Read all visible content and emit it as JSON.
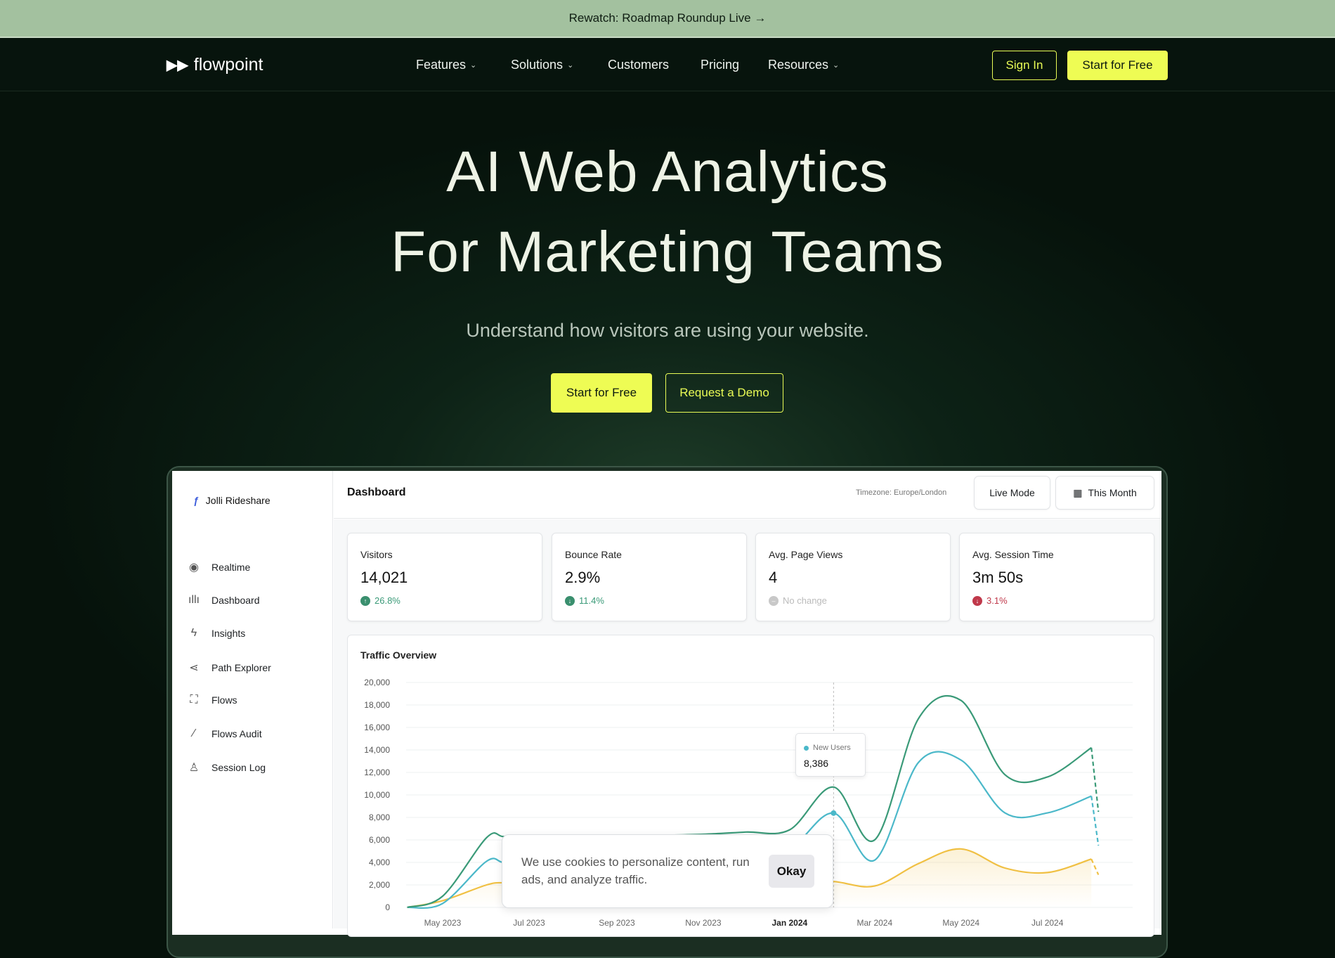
{
  "banner": {
    "text": "Rewatch: Roadmap Roundup Live",
    "arrow": "→"
  },
  "nav": {
    "logo": "flowpoint",
    "items": [
      {
        "label": "Features",
        "dropdown": true
      },
      {
        "label": "Solutions",
        "dropdown": true
      },
      {
        "label": "Customers",
        "dropdown": false
      },
      {
        "label": "Pricing",
        "dropdown": false
      },
      {
        "label": "Resources",
        "dropdown": true
      }
    ],
    "sign_in": "Sign In",
    "start_free": "Start for Free"
  },
  "hero": {
    "title_line1": "AI Web Analytics",
    "title_line2": "For Marketing Teams",
    "subtitle": "Understand how visitors are using your website.",
    "cta_primary": "Start for Free",
    "cta_secondary": "Request a Demo"
  },
  "colors": {
    "accent": "#eefc54",
    "banner": "#a3c19f",
    "background": "#06120b",
    "green": "#3a9a78",
    "teal": "#4bb8c9",
    "yellow": "#f0c043",
    "down": "#c0394b"
  },
  "dashboard": {
    "workspace": "Jolli Rideshare",
    "sidebar": [
      {
        "label": "Realtime",
        "icon": "eye-icon"
      },
      {
        "label": "Dashboard",
        "icon": "bars-icon"
      },
      {
        "label": "Insights",
        "icon": "lightning-icon"
      },
      {
        "label": "Path Explorer",
        "icon": "share-icon"
      },
      {
        "label": "Flows",
        "icon": "flows-icon"
      },
      {
        "label": "Flows Audit",
        "icon": "magic-wand-icon"
      },
      {
        "label": "Session Log",
        "icon": "user-icon"
      }
    ],
    "title": "Dashboard",
    "timezone": "Timezone: Europe/London",
    "live_mode": "Live Mode",
    "range": "This Month",
    "metrics": [
      {
        "label": "Visitors",
        "value": "14,021",
        "change": "26.8%",
        "trend": "up"
      },
      {
        "label": "Bounce Rate",
        "value": "2.9%",
        "change": "11.4%",
        "trend": "down-good"
      },
      {
        "label": "Avg. Page Views",
        "value": "4",
        "change": "No change",
        "trend": "none"
      },
      {
        "label": "Avg. Session Time",
        "value": "3m 50s",
        "change": "3.1%",
        "trend": "down-bad"
      }
    ],
    "chart_title": "Traffic Overview",
    "tooltip": {
      "series": "New Users",
      "value": "8,386"
    }
  },
  "cookie": {
    "text": "We use cookies to personalize content, run ads, and analyze traffic.",
    "button": "Okay"
  },
  "chart_data": {
    "type": "line",
    "title": "Traffic Overview",
    "ylim": [
      0,
      20000
    ],
    "yticks": [
      "0",
      "2,000",
      "4,000",
      "6,000",
      "8,000",
      "10,000",
      "12,000",
      "14,000",
      "16,000",
      "18,000",
      "20,000"
    ],
    "xticks": [
      {
        "label": "May 2023",
        "date": "2023-05-01"
      },
      {
        "label": "Jul 2023",
        "date": "2023-07-01"
      },
      {
        "label": "Sep 2023",
        "date": "2023-09-01"
      },
      {
        "label": "Nov 2023",
        "date": "2023-11-01"
      },
      {
        "label": "Jan 2024",
        "date": "2024-01-01",
        "bold": true
      },
      {
        "label": "Mar 2024",
        "date": "2024-03-01"
      },
      {
        "label": "May 2024",
        "date": "2024-05-01"
      },
      {
        "label": "Jul 2024",
        "date": "2024-07-01"
      }
    ],
    "grid": true,
    "x": [
      "2023-04-06",
      "2023-05-01",
      "2023-06-01",
      "2023-06-13",
      "2023-07-01",
      "2023-08-01",
      "2023-09-01",
      "2023-10-01",
      "2023-11-01",
      "2023-12-01",
      "2024-01-01",
      "2024-02-01",
      "2024-03-01",
      "2024-04-01",
      "2024-05-01",
      "2024-06-01",
      "2024-07-01",
      "2024-08-01",
      "2024-08-06"
    ],
    "series": [
      {
        "color": "#3a9a78",
        "values": [
          0,
          1000,
          6200,
          6300,
          6300,
          6300,
          6300,
          6400,
          6500,
          6700,
          6900,
          10700,
          6000,
          16800,
          18400,
          11800,
          11600,
          14200,
          8500
        ]
      },
      {
        "name": "New Users",
        "color": "#4bb8c9",
        "values": [
          0,
          350,
          4100,
          4000,
          4000,
          4000,
          4100,
          4200,
          4400,
          4800,
          5200,
          8386,
          4200,
          12900,
          13100,
          8400,
          8400,
          9900,
          5500
        ]
      },
      {
        "color": "#f0c043",
        "fill": true,
        "values": [
          0,
          600,
          2000,
          2200,
          2200,
          2200,
          2200,
          2300,
          2300,
          2400,
          2400,
          2300,
          1900,
          3900,
          5200,
          3500,
          3100,
          4300,
          2900
        ]
      }
    ],
    "projected_last_segment": true,
    "highlight": {
      "series": "New Users",
      "date": "2024-02-01",
      "value": 8386
    }
  }
}
